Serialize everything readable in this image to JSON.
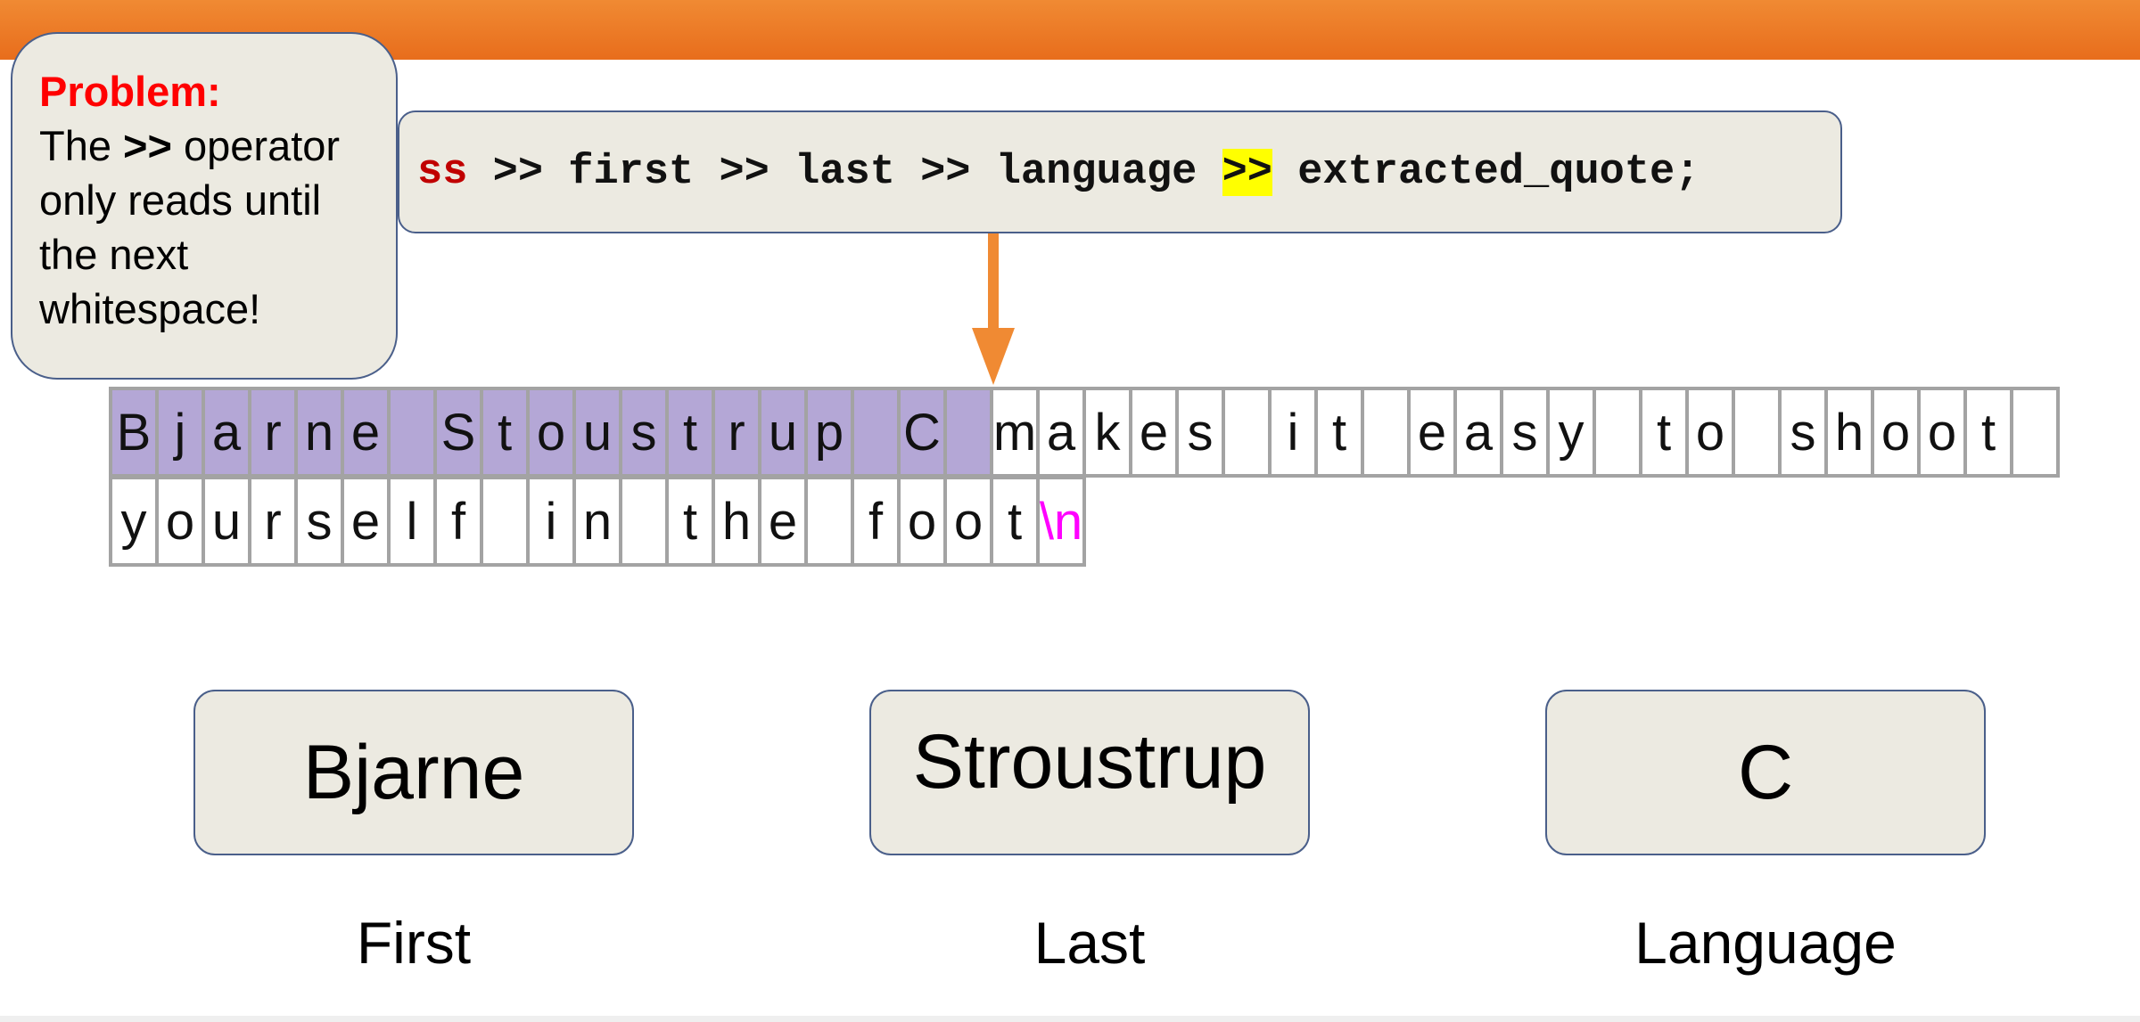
{
  "callout": {
    "title": "Problem:",
    "text_before": "The ",
    "operator": ">>",
    "text_after": " operator only reads until the next whitespace!"
  },
  "code": {
    "stream": "ss",
    "middle": " >> first >> last >> language ",
    "highlighted_op": ">>",
    "end": " extracted_quote;"
  },
  "buffer": {
    "row1": [
      "B",
      "j",
      "a",
      "r",
      "n",
      "e",
      " ",
      "S",
      "t",
      "o",
      "u",
      "s",
      "t",
      "r",
      "u",
      "p",
      " ",
      "C",
      " ",
      "m",
      "a",
      "k",
      "e",
      "s",
      " ",
      "i",
      "t",
      " ",
      "e",
      "a",
      "s",
      "y",
      " ",
      "t",
      "o",
      " ",
      "s",
      "h",
      "o",
      "o",
      "t",
      " "
    ],
    "row2": [
      "y",
      "o",
      "u",
      "r",
      "s",
      "e",
      "l",
      "f",
      " ",
      "i",
      "n",
      " ",
      "t",
      "h",
      "e",
      " ",
      "f",
      "o",
      "o",
      "t",
      "\\n"
    ],
    "row1_read_count": 19
  },
  "results": [
    {
      "value": "Bjarne",
      "label": "First"
    },
    {
      "value": "Stroustrup",
      "label": "Last"
    },
    {
      "value": "C",
      "label": "Language"
    }
  ],
  "colors": {
    "header_orange": "#e86d1c",
    "arrow_orange": "#f08a33",
    "read_purple": "#b4a7d6",
    "problem_red": "#ff0000",
    "newline_magenta": "#ff00ff",
    "highlight_yellow": "#ffff00"
  }
}
